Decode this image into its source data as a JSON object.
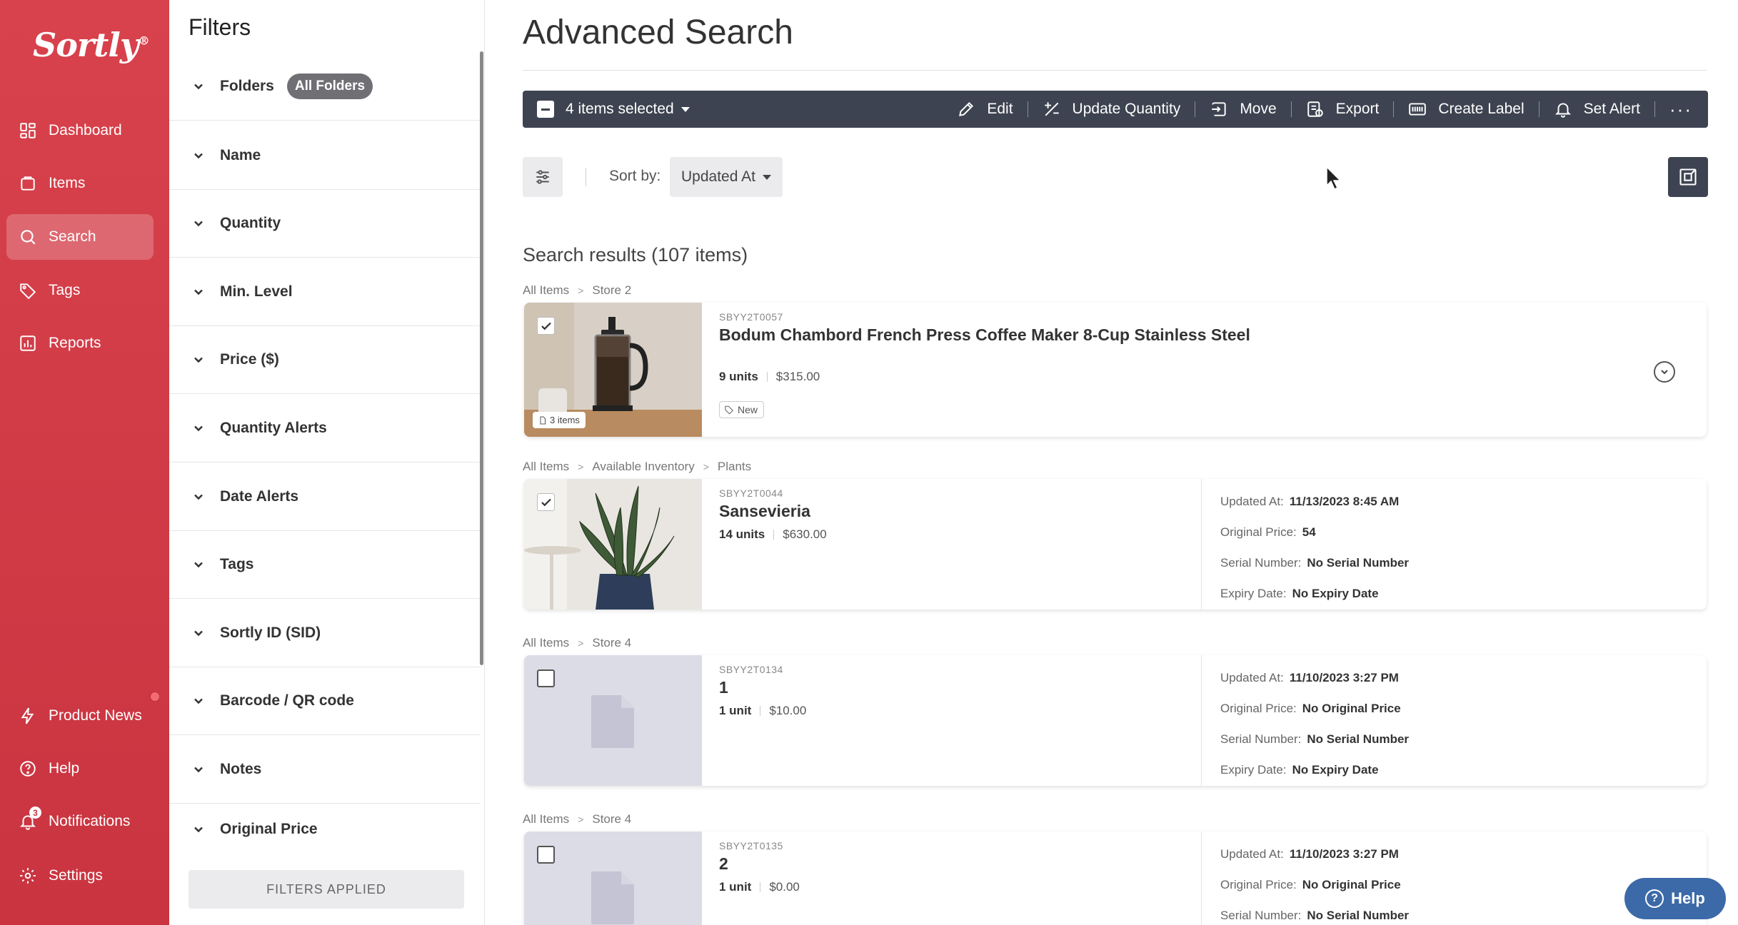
{
  "brand": {
    "logo": "Sortly",
    "reg": "®",
    "accent": "#d8424c"
  },
  "nav": {
    "dashboard": "Dashboard",
    "items": "Items",
    "search": "Search",
    "tags": "Tags",
    "reports": "Reports",
    "product_news": "Product News",
    "help": "Help",
    "notifications": "Notifications",
    "notifications_count": "3",
    "settings": "Settings"
  },
  "filters": {
    "title": "Filters",
    "rows": [
      "Folders",
      "Name",
      "Quantity",
      "Min. Level",
      "Price ($)",
      "Quantity Alerts",
      "Date Alerts",
      "Tags",
      "Sortly ID (SID)",
      "Barcode / QR code",
      "Notes",
      "Original Price"
    ],
    "folders_chip": "All Folders",
    "applied_button": "FILTERS APPLIED"
  },
  "main": {
    "title": "Advanced Search",
    "selection": "4 items selected",
    "actions": {
      "edit": "Edit",
      "update_quantity": "Update Quantity",
      "move": "Move",
      "export": "Export",
      "create_label": "Create Label",
      "set_alert": "Set Alert",
      "more": "···"
    },
    "sort_label": "Sort by:",
    "sort_value": "Updated At",
    "results_title": "Search results (107 items)"
  },
  "results": [
    {
      "crumb": [
        "All Items",
        "Store 2"
      ],
      "sid": "SBYY2T0057",
      "name": "Bodum Chambord French Press Coffee Maker 8-Cup Stainless Steel",
      "qty": "9 units",
      "price": "$315.00",
      "tag": "New",
      "count": "3 items",
      "checked": true
    },
    {
      "crumb": [
        "All Items",
        "Available Inventory",
        "Plants"
      ],
      "sid": "SBYY2T0044",
      "name": "Sansevieria",
      "qty": "14 units",
      "price": "$630.00",
      "checked": true,
      "details": [
        {
          "label": "Updated At:",
          "value": "11/13/2023 8:45 AM"
        },
        {
          "label": "Original Price:",
          "value": "54"
        },
        {
          "label": "Serial Number:",
          "value": "No Serial Number"
        },
        {
          "label": "Expiry Date:",
          "value": "No Expiry Date"
        }
      ]
    },
    {
      "crumb": [
        "All Items",
        "Store 4"
      ],
      "sid": "SBYY2T0134",
      "name": "1",
      "qty": "1 unit",
      "price": "$10.00",
      "checked": false,
      "details": [
        {
          "label": "Updated At:",
          "value": "11/10/2023 3:27 PM"
        },
        {
          "label": "Original Price:",
          "value": "No Original Price"
        },
        {
          "label": "Serial Number:",
          "value": "No Serial Number"
        },
        {
          "label": "Expiry Date:",
          "value": "No Expiry Date"
        }
      ]
    },
    {
      "crumb": [
        "All Items",
        "Store 4"
      ],
      "sid": "SBYY2T0135",
      "name": "2",
      "qty": "1 unit",
      "price": "$0.00",
      "checked": false,
      "details": [
        {
          "label": "Updated At:",
          "value": "11/10/2023 3:27 PM"
        },
        {
          "label": "Original Price:",
          "value": "No Original Price"
        },
        {
          "label": "Serial Number:",
          "value": "No Serial Number"
        }
      ]
    }
  ],
  "help_fab": "Help"
}
